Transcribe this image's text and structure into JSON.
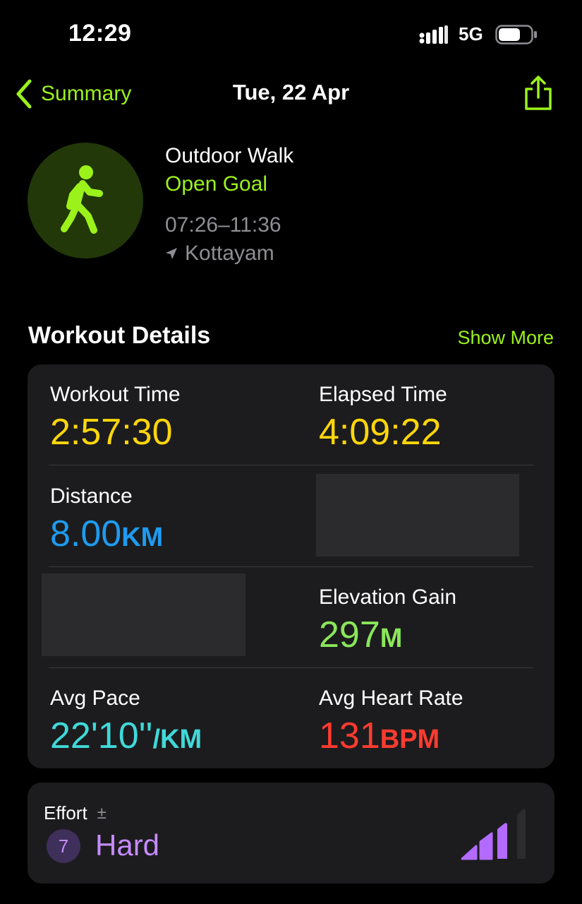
{
  "status_bar": {
    "time": "12:29",
    "network": "5G"
  },
  "nav": {
    "back_label": "Summary",
    "title": "Tue, 22 Apr"
  },
  "workout": {
    "type": "Outdoor Walk",
    "goal": "Open Goal",
    "time_range": "07:26–11:36",
    "location": "Kottayam"
  },
  "details": {
    "title": "Workout Details",
    "show_more": "Show More",
    "workout_time": {
      "label": "Workout Time",
      "value": "2:57:30",
      "color": "#ffd60a"
    },
    "elapsed_time": {
      "label": "Elapsed Time",
      "value": "4:09:22",
      "color": "#ffd60a"
    },
    "distance": {
      "label": "Distance",
      "value": "8.00",
      "unit": "KM",
      "color": "#1e9bf0"
    },
    "elevation_gain": {
      "label": "Elevation Gain",
      "value": "297",
      "unit": "M",
      "color": "#8ae65a"
    },
    "avg_pace": {
      "label": "Avg Pace",
      "value": "22'10''",
      "unit": "/KM",
      "color": "#40d9d9"
    },
    "avg_heart_rate": {
      "label": "Avg Heart Rate",
      "value": "131",
      "unit": "BPM",
      "color": "#ff3b30"
    }
  },
  "effort": {
    "label": "Effort",
    "adjust_symbol": "±",
    "score": "7",
    "level": "Hard",
    "color": "#c58bff",
    "bars_filled": 3,
    "bars_total": 4
  },
  "accent_color": "#9bf21a"
}
